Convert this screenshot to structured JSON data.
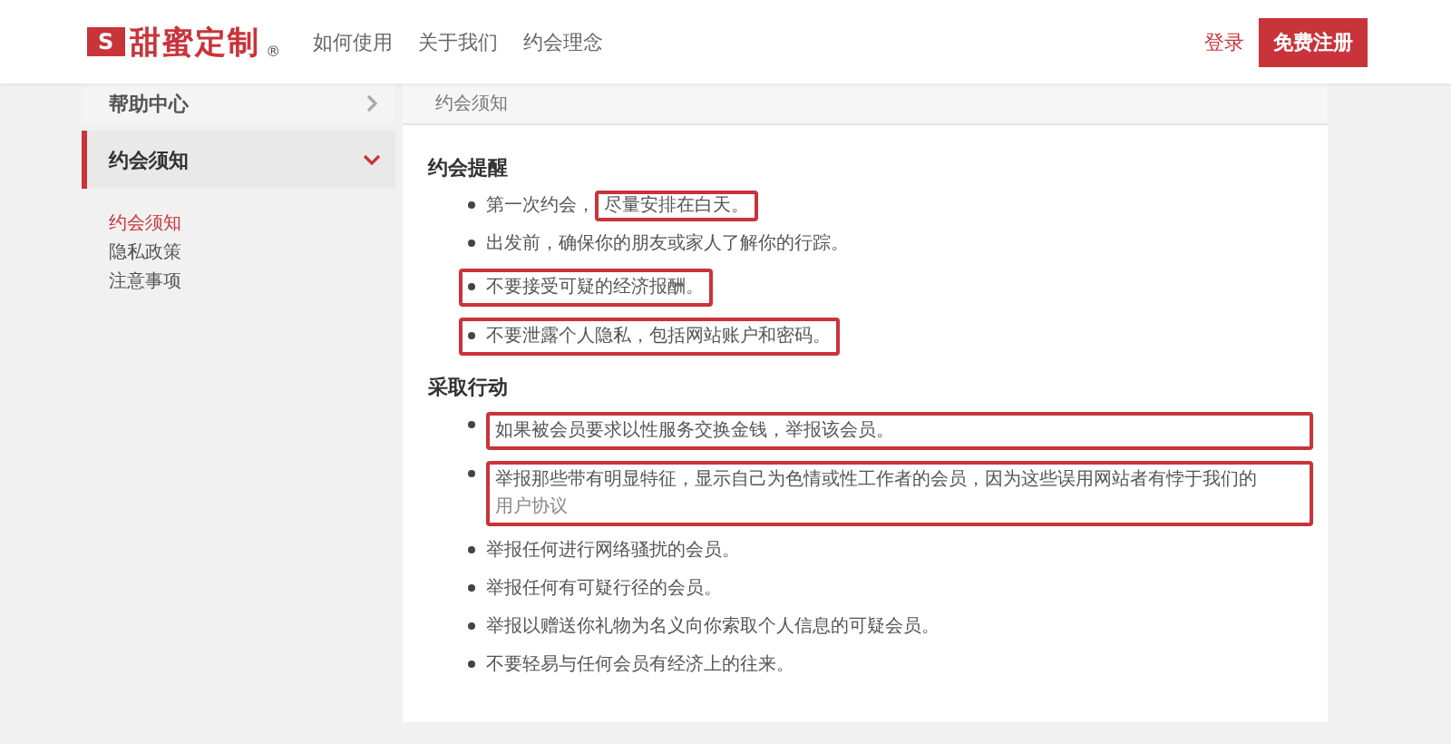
{
  "header": {
    "logo": {
      "badge": "S",
      "text": "甜蜜定制",
      "mark": "®"
    },
    "nav": [
      {
        "label": "如何使用"
      },
      {
        "label": "关于我们"
      },
      {
        "label": "约会理念"
      }
    ],
    "login": "登录",
    "register": "免费注册"
  },
  "sidebar": {
    "items": [
      {
        "label": "帮助中心",
        "selected": false,
        "expanded": false
      },
      {
        "label": "约会须知",
        "selected": true,
        "expanded": true,
        "children": [
          {
            "label": "约会须知",
            "selected": true
          },
          {
            "label": "隐私政策",
            "selected": false
          },
          {
            "label": "注意事项",
            "selected": false
          }
        ]
      }
    ]
  },
  "panel": {
    "title": "约会须知",
    "sections": [
      {
        "heading": "约会提醒",
        "items": [
          {
            "kind": "part",
            "segments": [
              {
                "text": "第一次约会，",
                "highlighted": false
              },
              {
                "text": "尽量安排在白天。",
                "highlighted": true
              }
            ]
          },
          {
            "kind": "plain",
            "segments": [
              {
                "text": "出发前，确保你的朋友或家人了解你的行踪。",
                "kind": "text"
              }
            ]
          },
          {
            "kind": "line",
            "segments": [
              {
                "text": "不要接受可疑的经济报酬。",
                "kind": "text"
              }
            ]
          },
          {
            "kind": "line",
            "segments": [
              {
                "text": "不要泄露个人隐私，包括网站账户和密码。",
                "kind": "text"
              }
            ]
          }
        ]
      },
      {
        "heading": "采取行动",
        "items": [
          {
            "kind": "block",
            "segments": [
              {
                "text": "如果被会员要求以性服务交换金钱，举报该会员。",
                "kind": "text"
              }
            ]
          },
          {
            "kind": "block",
            "segments": [
              {
                "text": "举报那些带有明显特征，显示自己为色情或性工作者的会员，因为这些误用网站者有悖于我们的",
                "kind": "text"
              },
              {
                "text": "用户协议",
                "kind": "link"
              }
            ]
          },
          {
            "kind": "plain",
            "segments": [
              {
                "text": "举报任何进行网络骚扰的会员。",
                "kind": "text"
              }
            ]
          },
          {
            "kind": "plain",
            "segments": [
              {
                "text": "举报任何有可疑行径的会员。",
                "kind": "text"
              }
            ]
          },
          {
            "kind": "plain",
            "segments": [
              {
                "text": "举报以赠送你礼物为名义向你索取个人信息的可疑会员。",
                "kind": "text"
              }
            ]
          },
          {
            "kind": "plain",
            "segments": [
              {
                "text": "不要轻易与任何会员有经济上的往来。",
                "kind": "text"
              }
            ]
          }
        ]
      }
    ]
  }
}
